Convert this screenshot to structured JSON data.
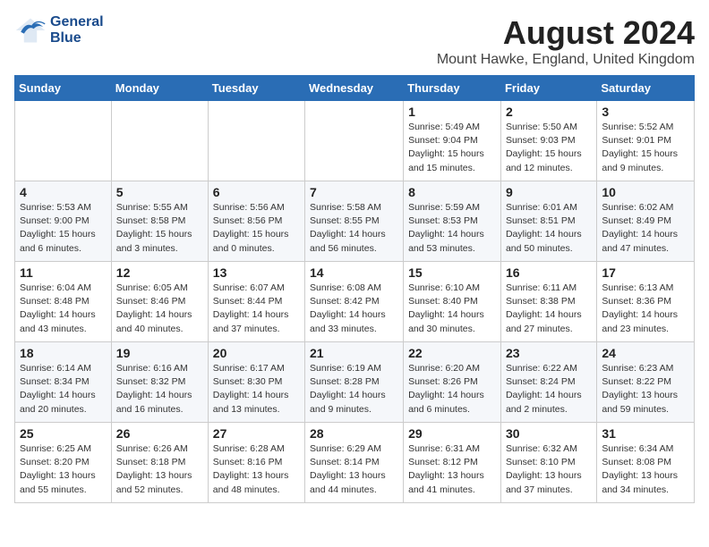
{
  "logo": {
    "line1": "General",
    "line2": "Blue"
  },
  "title": "August 2024",
  "subtitle": "Mount Hawke, England, United Kingdom",
  "days_of_week": [
    "Sunday",
    "Monday",
    "Tuesday",
    "Wednesday",
    "Thursday",
    "Friday",
    "Saturday"
  ],
  "weeks": [
    [
      {
        "day": "",
        "info": ""
      },
      {
        "day": "",
        "info": ""
      },
      {
        "day": "",
        "info": ""
      },
      {
        "day": "",
        "info": ""
      },
      {
        "day": "1",
        "info": "Sunrise: 5:49 AM\nSunset: 9:04 PM\nDaylight: 15 hours\nand 15 minutes."
      },
      {
        "day": "2",
        "info": "Sunrise: 5:50 AM\nSunset: 9:03 PM\nDaylight: 15 hours\nand 12 minutes."
      },
      {
        "day": "3",
        "info": "Sunrise: 5:52 AM\nSunset: 9:01 PM\nDaylight: 15 hours\nand 9 minutes."
      }
    ],
    [
      {
        "day": "4",
        "info": "Sunrise: 5:53 AM\nSunset: 9:00 PM\nDaylight: 15 hours\nand 6 minutes."
      },
      {
        "day": "5",
        "info": "Sunrise: 5:55 AM\nSunset: 8:58 PM\nDaylight: 15 hours\nand 3 minutes."
      },
      {
        "day": "6",
        "info": "Sunrise: 5:56 AM\nSunset: 8:56 PM\nDaylight: 15 hours\nand 0 minutes."
      },
      {
        "day": "7",
        "info": "Sunrise: 5:58 AM\nSunset: 8:55 PM\nDaylight: 14 hours\nand 56 minutes."
      },
      {
        "day": "8",
        "info": "Sunrise: 5:59 AM\nSunset: 8:53 PM\nDaylight: 14 hours\nand 53 minutes."
      },
      {
        "day": "9",
        "info": "Sunrise: 6:01 AM\nSunset: 8:51 PM\nDaylight: 14 hours\nand 50 minutes."
      },
      {
        "day": "10",
        "info": "Sunrise: 6:02 AM\nSunset: 8:49 PM\nDaylight: 14 hours\nand 47 minutes."
      }
    ],
    [
      {
        "day": "11",
        "info": "Sunrise: 6:04 AM\nSunset: 8:48 PM\nDaylight: 14 hours\nand 43 minutes."
      },
      {
        "day": "12",
        "info": "Sunrise: 6:05 AM\nSunset: 8:46 PM\nDaylight: 14 hours\nand 40 minutes."
      },
      {
        "day": "13",
        "info": "Sunrise: 6:07 AM\nSunset: 8:44 PM\nDaylight: 14 hours\nand 37 minutes."
      },
      {
        "day": "14",
        "info": "Sunrise: 6:08 AM\nSunset: 8:42 PM\nDaylight: 14 hours\nand 33 minutes."
      },
      {
        "day": "15",
        "info": "Sunrise: 6:10 AM\nSunset: 8:40 PM\nDaylight: 14 hours\nand 30 minutes."
      },
      {
        "day": "16",
        "info": "Sunrise: 6:11 AM\nSunset: 8:38 PM\nDaylight: 14 hours\nand 27 minutes."
      },
      {
        "day": "17",
        "info": "Sunrise: 6:13 AM\nSunset: 8:36 PM\nDaylight: 14 hours\nand 23 minutes."
      }
    ],
    [
      {
        "day": "18",
        "info": "Sunrise: 6:14 AM\nSunset: 8:34 PM\nDaylight: 14 hours\nand 20 minutes."
      },
      {
        "day": "19",
        "info": "Sunrise: 6:16 AM\nSunset: 8:32 PM\nDaylight: 14 hours\nand 16 minutes."
      },
      {
        "day": "20",
        "info": "Sunrise: 6:17 AM\nSunset: 8:30 PM\nDaylight: 14 hours\nand 13 minutes."
      },
      {
        "day": "21",
        "info": "Sunrise: 6:19 AM\nSunset: 8:28 PM\nDaylight: 14 hours\nand 9 minutes."
      },
      {
        "day": "22",
        "info": "Sunrise: 6:20 AM\nSunset: 8:26 PM\nDaylight: 14 hours\nand 6 minutes."
      },
      {
        "day": "23",
        "info": "Sunrise: 6:22 AM\nSunset: 8:24 PM\nDaylight: 14 hours\nand 2 minutes."
      },
      {
        "day": "24",
        "info": "Sunrise: 6:23 AM\nSunset: 8:22 PM\nDaylight: 13 hours\nand 59 minutes."
      }
    ],
    [
      {
        "day": "25",
        "info": "Sunrise: 6:25 AM\nSunset: 8:20 PM\nDaylight: 13 hours\nand 55 minutes."
      },
      {
        "day": "26",
        "info": "Sunrise: 6:26 AM\nSunset: 8:18 PM\nDaylight: 13 hours\nand 52 minutes."
      },
      {
        "day": "27",
        "info": "Sunrise: 6:28 AM\nSunset: 8:16 PM\nDaylight: 13 hours\nand 48 minutes."
      },
      {
        "day": "28",
        "info": "Sunrise: 6:29 AM\nSunset: 8:14 PM\nDaylight: 13 hours\nand 44 minutes."
      },
      {
        "day": "29",
        "info": "Sunrise: 6:31 AM\nSunset: 8:12 PM\nDaylight: 13 hours\nand 41 minutes."
      },
      {
        "day": "30",
        "info": "Sunrise: 6:32 AM\nSunset: 8:10 PM\nDaylight: 13 hours\nand 37 minutes."
      },
      {
        "day": "31",
        "info": "Sunrise: 6:34 AM\nSunset: 8:08 PM\nDaylight: 13 hours\nand 34 minutes."
      }
    ]
  ]
}
